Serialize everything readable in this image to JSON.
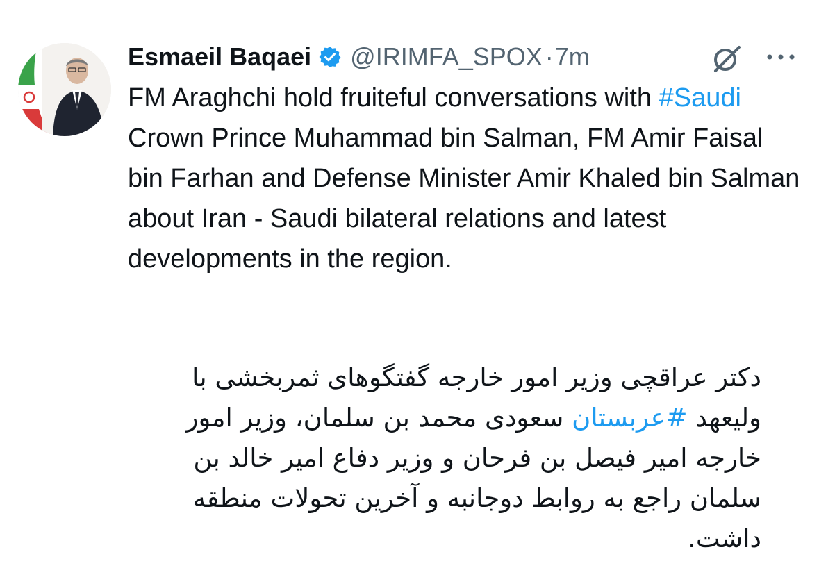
{
  "author": {
    "display_name": "Esmaeil Baqaei",
    "handle": "@IRIMFA_SPOX",
    "separator": "·",
    "time": "7m",
    "verified_icon": "verified-badge-icon",
    "avatar_icon": "profile-avatar"
  },
  "actions": {
    "grok_icon": "grok-icon",
    "more_icon": "more-options-icon"
  },
  "tweet": {
    "english": {
      "before_hashtag": "FM Araghchi hold fruiteful conversations with ",
      "hashtag": "#Saudi",
      "after_hashtag": " Crown Prince Muhammad bin Salman, FM Amir Faisal bin Farhan and Defense Minister Amir Khaled bin Salman about Iran - Saudi bilateral relations and latest developments in the region."
    },
    "persian": {
      "before_hashtag": "دکتر عراقچی وزیر امور خارجه گفتگوهای ثمربخشی با ولیعهد ",
      "hashtag": "#عربستان",
      "after_hashtag": " سعودی محمد بن سلمان، وزیر امور خارجه امیر فیصل بن فرحان و وزیر دفاع امیر خالد بن سلمان راجع به روابط دوجانبه و آخرین تحولات منطقه داشت."
    }
  },
  "colors": {
    "text": "#0f1419",
    "secondary": "#536471",
    "link": "#1d9bf0",
    "verified": "#1d9bf0"
  }
}
